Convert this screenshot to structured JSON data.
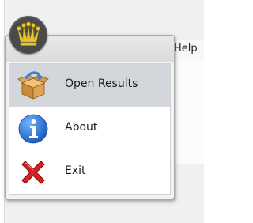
{
  "menubar": {
    "help_tab": "Help"
  },
  "app_menu": {
    "items": [
      {
        "label": "Open Results",
        "icon": "open-box-icon",
        "highlighted": true
      },
      {
        "label": "About",
        "icon": "info-icon",
        "highlighted": false
      },
      {
        "label": "Exit",
        "icon": "close-x-icon",
        "highlighted": false
      }
    ]
  },
  "colors": {
    "highlight": "#d3d6db",
    "app_button": "#4a4a4a",
    "crown": "#e8c52a",
    "info_blue": "#1f5fbf",
    "exit_red": "#d42020"
  }
}
